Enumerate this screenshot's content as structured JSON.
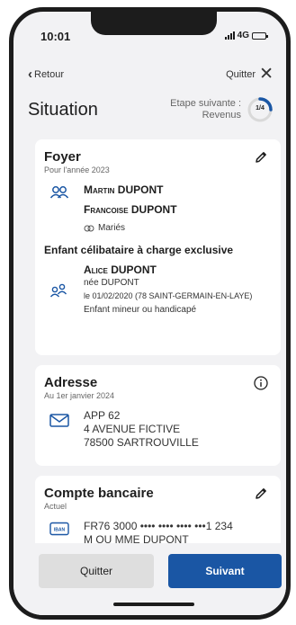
{
  "status_bar": {
    "time": "10:01",
    "network": "4G"
  },
  "nav": {
    "back_label": "Retour",
    "quit_label": "Quitter"
  },
  "header": {
    "title": "Situation",
    "next_step_label": "Etape suivante :",
    "next_step_value": "Revenus",
    "progress_label": "1/4",
    "progress_fraction": 0.25,
    "accent_color": "#1a56a4"
  },
  "foyer": {
    "title": "Foyer",
    "subtitle": "Pour l'année 2023",
    "person1": "Martin DUPONT",
    "person2": "Francoise DUPONT",
    "status": "Mariés",
    "child_heading": "Enfant célibataire à charge exclusive",
    "child": {
      "name": "Alice DUPONT",
      "birth_name": "née DUPONT",
      "birth_info": "le 01/02/2020 (78 SAINT-GERMAIN-EN-LAYE)",
      "category": "Enfant mineur ou handicapé"
    },
    "icons": {
      "couple": "couple-icon",
      "child": "child-icon",
      "edit": "pencil-icon",
      "status": "rings-icon"
    }
  },
  "adresse": {
    "title": "Adresse",
    "subtitle": "Au 1er janvier 2024",
    "lines": [
      "APP 62",
      "4 AVENUE FICTIVE",
      "78500 SARTROUVILLE"
    ],
    "icons": {
      "mail": "envelope-icon",
      "info": "info-icon"
    }
  },
  "compte": {
    "title": "Compte bancaire",
    "subtitle": "Actuel",
    "iban": "FR76 3000 •••• •••• •••• •••1 234",
    "holder": "M OU MME DUPONT",
    "icons": {
      "card": "iban-card-icon",
      "edit": "pencil-icon"
    },
    "card_label": "IBAN"
  },
  "buttons": {
    "quit": "Quitter",
    "next": "Suivant"
  }
}
